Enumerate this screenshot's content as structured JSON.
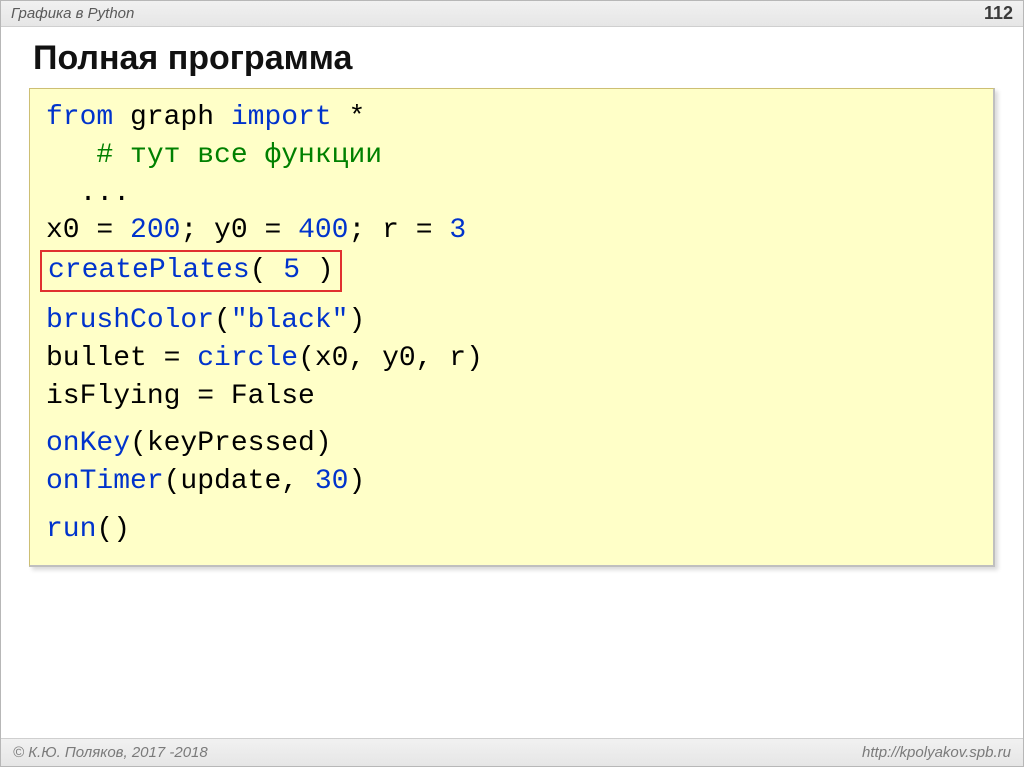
{
  "header": {
    "left": "Графика в Python",
    "page": "112"
  },
  "title": "Полная программа",
  "code": {
    "l1_kw1": "from",
    "l1_mod": " graph ",
    "l1_kw2": "import",
    "l1_star": " *",
    "l2_indent": "   ",
    "l2_cmt": "# тут все функции",
    "l3": "  ...",
    "l4_a": "x0 = ",
    "l4_n1": "200",
    "l4_b": "; y0 = ",
    "l4_n2": "400",
    "l4_c": "; r = ",
    "l4_n3": "3",
    "l5_fn": "createPlates",
    "l5_a": "( ",
    "l5_n": "5",
    "l5_b": " )",
    "l6_fn": "brushColor",
    "l6_a": "(",
    "l6_s": "\"black\"",
    "l6_b": ")",
    "l7_a": "bullet = ",
    "l7_fn": "circle",
    "l7_b": "(x0, y0, r)",
    "l8": "isFlying = False",
    "l9_fn": "onKey",
    "l9_a": "(keyPressed)",
    "l10_fn": "onTimer",
    "l10_a": "(update, ",
    "l10_n": "30",
    "l10_b": ")",
    "l11_fn": "run",
    "l11_a": "()"
  },
  "footer": {
    "left": "© К.Ю. Поляков, 2017 -2018",
    "right": "http://kpolyakov.spb.ru"
  }
}
